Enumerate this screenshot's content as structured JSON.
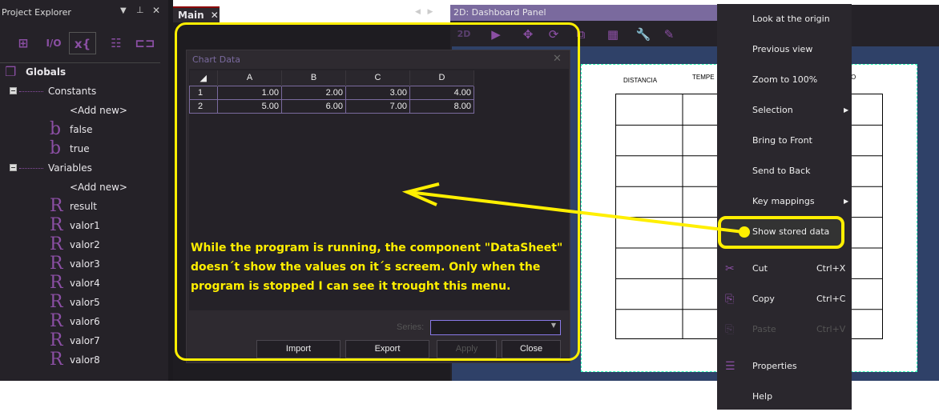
{
  "project_explorer": {
    "title": "Project Explorer",
    "toolbar_icons": [
      "grid-icon",
      "io-icon",
      "variables-icon",
      "function-block-icon",
      "component-icon"
    ],
    "tree": [
      {
        "label": "Globals",
        "icon": "globals-icon",
        "level": 0
      },
      {
        "label": "Constants",
        "level": 1,
        "expanded": true
      },
      {
        "label": "<Add new>",
        "level": 2
      },
      {
        "label": "false",
        "icon": "boolean-icon",
        "glyph": "b",
        "level": 2
      },
      {
        "label": "true",
        "icon": "boolean-icon",
        "glyph": "b",
        "level": 2
      },
      {
        "label": "Variables",
        "level": 1,
        "expanded": true
      },
      {
        "label": "<Add new>",
        "level": 2
      },
      {
        "label": "result",
        "icon": "real-icon",
        "glyph": "R",
        "level": 2
      },
      {
        "label": "valor1",
        "icon": "real-icon",
        "glyph": "R",
        "level": 2
      },
      {
        "label": "valor2",
        "icon": "real-icon",
        "glyph": "R",
        "level": 2
      },
      {
        "label": "valor3",
        "icon": "real-icon",
        "glyph": "R",
        "level": 2
      },
      {
        "label": "valor4",
        "icon": "real-icon",
        "glyph": "R",
        "level": 2
      },
      {
        "label": "valor5",
        "icon": "real-icon",
        "glyph": "R",
        "level": 2
      },
      {
        "label": "valor6",
        "icon": "real-icon",
        "glyph": "R",
        "level": 2
      },
      {
        "label": "valor7",
        "icon": "real-icon",
        "glyph": "R",
        "level": 2
      },
      {
        "label": "valor8",
        "icon": "real-icon",
        "glyph": "R",
        "level": 2
      }
    ]
  },
  "main_tab": {
    "label": "Main"
  },
  "dashboard": {
    "title": "2D: Dashboard Panel",
    "column_headers": [
      "DISTANCIA",
      "TEMPE",
      "O"
    ]
  },
  "dialog": {
    "title": "Chart Data",
    "columns": [
      "A",
      "B",
      "C",
      "D"
    ],
    "rows": [
      {
        "n": "1",
        "values": [
          "1.00",
          "2.00",
          "3.00",
          "4.00"
        ]
      },
      {
        "n": "2",
        "values": [
          "5.00",
          "6.00",
          "7.00",
          "8.00"
        ]
      }
    ],
    "series_label": "Series:",
    "series_value": "",
    "buttons": {
      "import": "Import",
      "export": "Export",
      "apply": "Apply",
      "close": "Close"
    }
  },
  "context_menu": [
    {
      "label": "Look at the origin"
    },
    {
      "label": "Previous view"
    },
    {
      "label": "Zoom to 100%"
    },
    {
      "label": "Selection",
      "submenu": true
    },
    {
      "label": "Bring to Front"
    },
    {
      "label": "Send to Back"
    },
    {
      "label": "Key mappings",
      "submenu": true
    },
    {
      "label": "Show stored data",
      "highlighted": true
    },
    {
      "label": "Cut",
      "shortcut": "Ctrl+X",
      "icon": "scissors-icon"
    },
    {
      "label": "Copy",
      "shortcut": "Ctrl+C",
      "icon": "copy-icon"
    },
    {
      "label": "Paste",
      "shortcut": "Ctrl+V",
      "icon": "paste-icon",
      "disabled": true
    },
    {
      "label": "Properties",
      "icon": "properties-icon"
    },
    {
      "label": "Help"
    }
  ],
  "annotation": {
    "text": "While the program is running, the component \"DataSheet\" doesn´t show the values on it´s screem. Only when the program is stopped I can see it trought this menu.",
    "color": "#ffef00"
  }
}
